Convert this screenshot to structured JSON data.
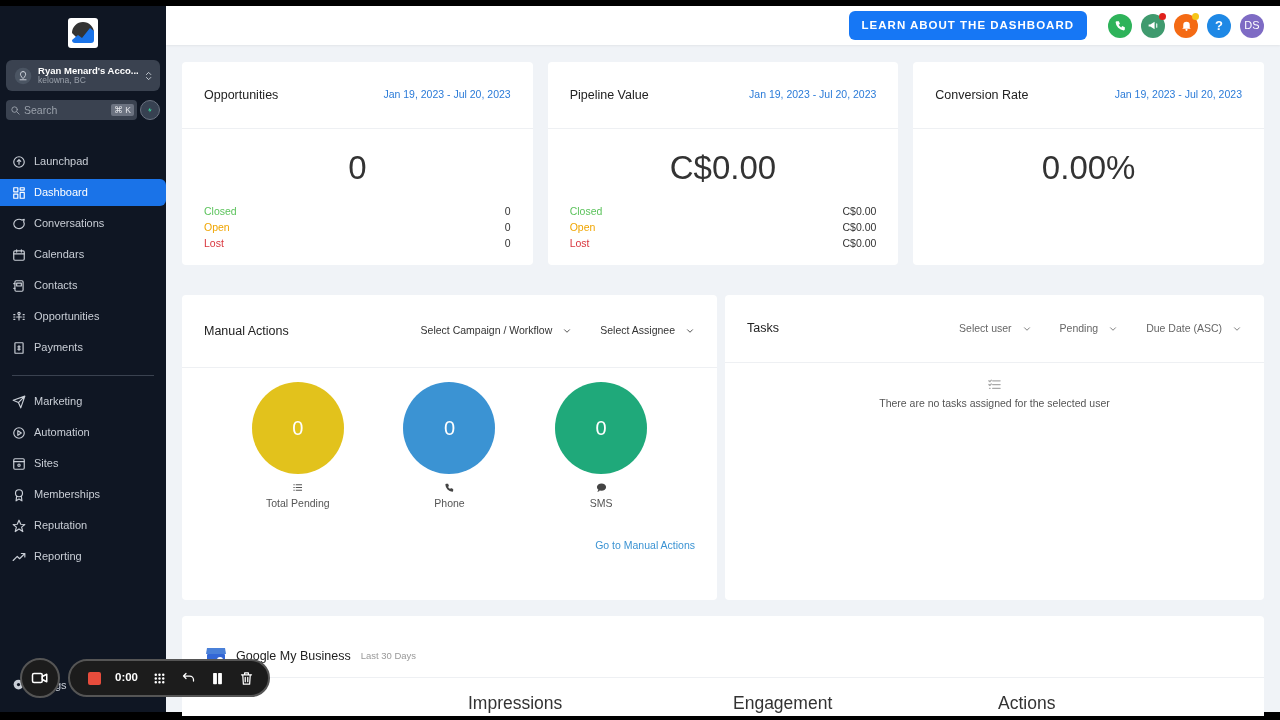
{
  "sidebar": {
    "account": {
      "name": "Ryan Menard's Acco...",
      "location": "kelowna, BC"
    },
    "search": {
      "placeholder": "Search",
      "shortcut": "⌘ K"
    },
    "nav_groups": [
      [
        {
          "label": "Launchpad",
          "selected": false
        },
        {
          "label": "Dashboard",
          "selected": true
        },
        {
          "label": "Conversations",
          "selected": false
        },
        {
          "label": "Calendars",
          "selected": false
        },
        {
          "label": "Contacts",
          "selected": false
        },
        {
          "label": "Opportunities",
          "selected": false
        },
        {
          "label": "Payments",
          "selected": false
        }
      ],
      [
        {
          "label": "Marketing",
          "selected": false
        },
        {
          "label": "Automation",
          "selected": false
        },
        {
          "label": "Sites",
          "selected": false
        },
        {
          "label": "Memberships",
          "selected": false
        },
        {
          "label": "Reputation",
          "selected": false
        },
        {
          "label": "Reporting",
          "selected": false
        }
      ]
    ],
    "settings_label": "gs"
  },
  "header": {
    "learn_button": "LEARN ABOUT THE DASHBOARD",
    "icons": [
      {
        "kind": "phone",
        "notification": false
      },
      {
        "kind": "megaphone",
        "notification": true
      },
      {
        "kind": "bell",
        "notification": true
      },
      {
        "kind": "help",
        "text": "?",
        "notification": false
      },
      {
        "kind": "avatar",
        "text": "DS",
        "notification": false
      }
    ]
  },
  "stat_cards": [
    {
      "title": "Opportunities",
      "date_range": "Jan 19, 2023 - Jul 20, 2023",
      "value": "0",
      "rows": [
        {
          "label": "Closed",
          "value": "0",
          "kind": "closed"
        },
        {
          "label": "Open",
          "value": "0",
          "kind": "open"
        },
        {
          "label": "Lost",
          "value": "0",
          "kind": "lost"
        }
      ]
    },
    {
      "title": "Pipeline Value",
      "date_range": "Jan 19, 2023 - Jul 20, 2023",
      "value": "C$0.00",
      "rows": [
        {
          "label": "Closed",
          "value": "C$0.00",
          "kind": "closed"
        },
        {
          "label": "Open",
          "value": "C$0.00",
          "kind": "open"
        },
        {
          "label": "Lost",
          "value": "C$0.00",
          "kind": "lost"
        }
      ]
    },
    {
      "title": "Conversion Rate",
      "date_range": "Jan 19, 2023 - Jul 20, 2023",
      "value": "0.00%"
    }
  ],
  "manual_actions": {
    "title": "Manual Actions",
    "filters": [
      "Select Campaign / Workflow",
      "Select Assignee"
    ],
    "circles": [
      {
        "kind": "list",
        "value": "0",
        "label": "Total Pending",
        "color": "#e2c21c"
      },
      {
        "kind": "phone",
        "value": "0",
        "label": "Phone",
        "color": "#3b93d3"
      },
      {
        "kind": "sms",
        "value": "0",
        "label": "SMS",
        "color": "#1fa97a"
      }
    ],
    "link": "Go to Manual Actions"
  },
  "tasks": {
    "title": "Tasks",
    "filters": [
      "Select user",
      "Pending",
      "Due Date (ASC)"
    ],
    "empty_message": "There are no tasks assigned for the selected user"
  },
  "gmb": {
    "title": "Google My Business",
    "period": "Last 30 Days",
    "columns": [
      "Impressions",
      "Engagement",
      "Actions"
    ]
  },
  "recorder": {
    "time": "0:00"
  }
}
